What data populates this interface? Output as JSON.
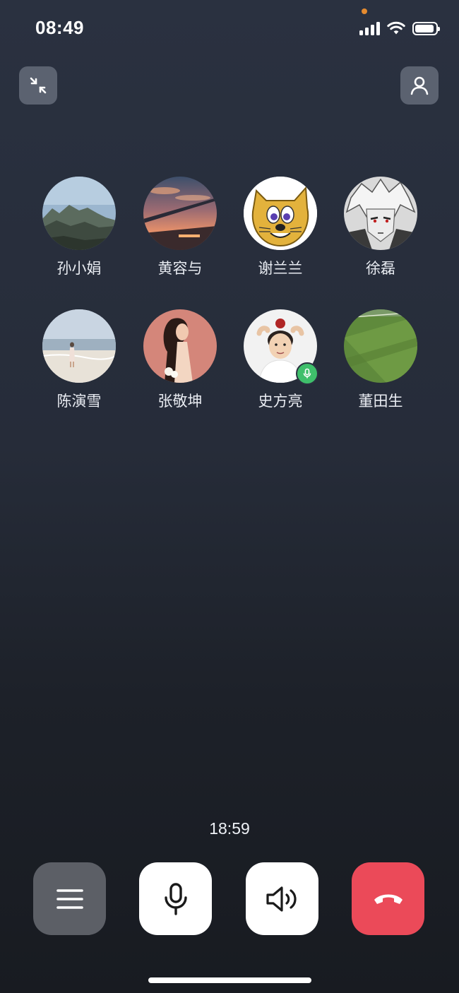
{
  "status_bar": {
    "time": "08:49",
    "battery_level": 0.95,
    "recording_dot_color": "#e58b2f"
  },
  "top_controls": {
    "minimize_icon": "collapse-arrows-icon",
    "add_member_icon": "person-icon"
  },
  "participants": [
    {
      "name": "孙小娟",
      "avatar": "mountain-landscape",
      "speaking": false
    },
    {
      "name": "黄容与",
      "avatar": "sunset-sky",
      "speaking": false
    },
    {
      "name": "谢兰兰",
      "avatar": "cartoon-cat",
      "speaking": false
    },
    {
      "name": "徐磊",
      "avatar": "anime-portrait",
      "speaking": false
    },
    {
      "name": "陈演雪",
      "avatar": "beach-figure",
      "speaking": false
    },
    {
      "name": "张敬坤",
      "avatar": "woman-portrait",
      "speaking": false
    },
    {
      "name": "史方亮",
      "avatar": "boy-with-apple",
      "speaking": true
    },
    {
      "name": "董田生",
      "avatar": "green-field",
      "speaking": false
    }
  ],
  "call": {
    "duration": "18:59"
  },
  "bottom_controls": {
    "menu_icon": "menu-icon",
    "mic_icon": "microphone-icon",
    "speaker_icon": "speaker-icon",
    "hangup_icon": "hang-up-icon",
    "hangup_color": "#eb4a59",
    "speaking_color": "#3fbf6b"
  }
}
